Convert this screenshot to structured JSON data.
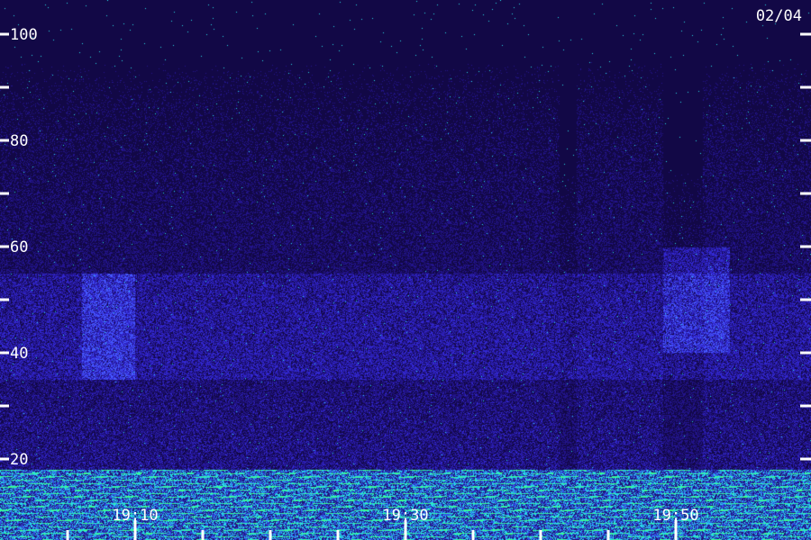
{
  "date_label": "02/04",
  "colors": {
    "background": "#10083a",
    "low": "#1a1470",
    "mid": "#3a3ae8",
    "high": "#28e0e0",
    "peak": "#40ff80",
    "ticks": "#ffffff"
  },
  "chart_data": {
    "type": "heatmap",
    "title": "",
    "xlabel": "",
    "ylabel": "",
    "ylim": [
      0,
      104
    ],
    "xlim": [
      "19:05",
      "19:54"
    ],
    "y_labeled_ticks": [
      20,
      40,
      60,
      80,
      100
    ],
    "y_minor_ticks": [
      30,
      50,
      70,
      90
    ],
    "x_labeled_ticks": [
      "19:10",
      "19:30",
      "19:50"
    ],
    "x_tick_labels": [
      "19:10",
      "19:30",
      "19:50"
    ],
    "x_minor_ticks": [
      "19:05",
      "19:15",
      "19:20",
      "19:25",
      "19:35",
      "19:40",
      "19:45"
    ],
    "bands": [
      {
        "name": "",
        "y_range": [
          0,
          18
        ],
        "intensity": "high"
      },
      {
        "name": "",
        "y_range": [
          35,
          55
        ],
        "intensity": "mid"
      }
    ],
    "bright_segments": [
      {
        "x_range": [
          "19:06",
          "19:10"
        ],
        "y_range": [
          35,
          55
        ]
      },
      {
        "x_range": [
          "19:49",
          "19:54"
        ],
        "y_range": [
          40,
          60
        ]
      }
    ],
    "grid": false
  }
}
